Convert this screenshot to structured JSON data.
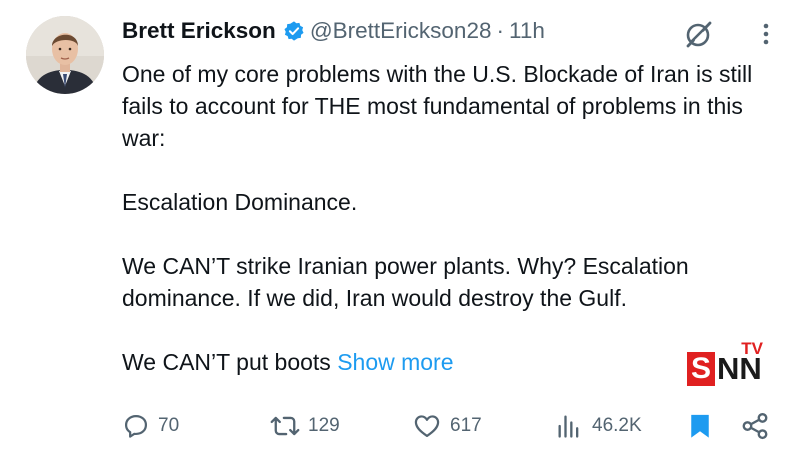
{
  "author": {
    "name": "Brett Erickson",
    "handle": "@BrettErickson28",
    "separator": "·",
    "time": "11h",
    "verified_color": "#1d9bf0"
  },
  "post": {
    "paragraphs": [
      "One of my core problems with the U.S. Blockade of Iran is still fails to account for THE most fundamental of problems in this war:",
      "Escalation Dominance.",
      "We CAN’T strike Iranian power plants. Why? Escalation dominance. If we did, Iran would destroy the Gulf."
    ],
    "truncated_text": "We CAN’T put boots",
    "show_more_label": "Show more"
  },
  "actions": {
    "reply_count": "70",
    "repost_count": "129",
    "like_count": "617",
    "views_count": "46.2K"
  },
  "watermark": {
    "tv": "TV",
    "s": "S",
    "nn": "NN"
  },
  "colors": {
    "text": "#0f1419",
    "secondary": "#536471",
    "link": "#1d9bf0",
    "bookmark": "#1d9bf0",
    "watermark_red": "#e02020"
  },
  "icons": [
    "verified-badge-icon",
    "grok-icon",
    "more-options-icon",
    "reply-icon",
    "repost-icon",
    "like-icon",
    "views-icon",
    "bookmark-icon",
    "share-icon"
  ]
}
